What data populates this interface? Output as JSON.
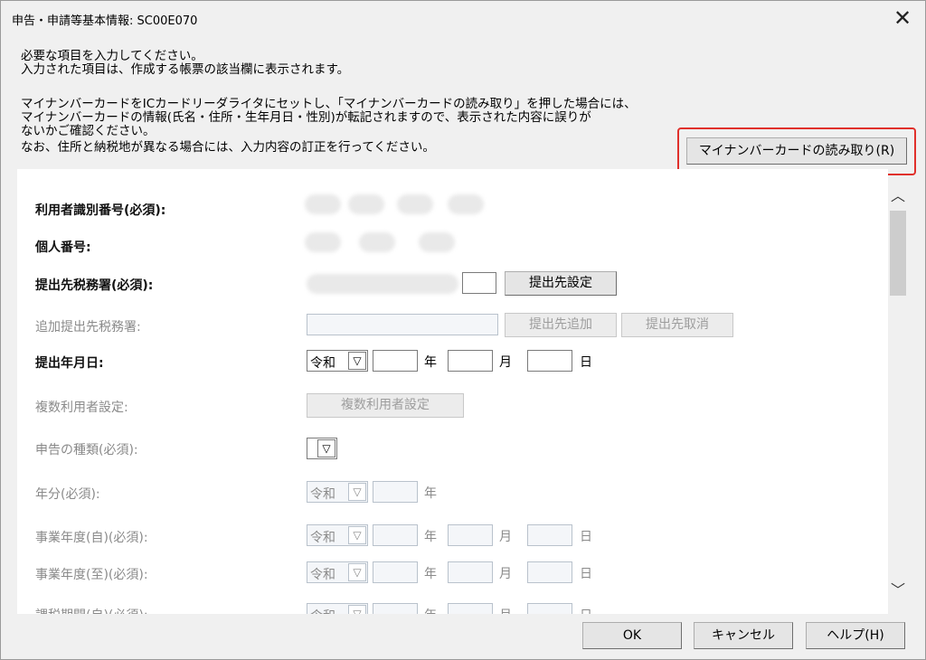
{
  "window": {
    "title": "申告・申請等基本情報: SC00E070"
  },
  "instructions": [
    "必要な項目を入力してください。",
    "入力された項目は、作成する帳票の該当欄に表示されます。",
    "マイナンバーカードをICカードリーダライタにセットし、「マイナンバーカードの読み取り」を押した場合には、",
    "マイナンバーカードの情報(氏名・住所・生年月日・性別)が転記されますので、表示された内容に誤りが",
    "ないかご確認ください。",
    "なお、住所と納税地が異なる場合には、入力内容の訂正を行ってください。"
  ],
  "mynumber_button": "マイナンバーカードの読み取り(R)",
  "form": {
    "user_id_label": "利用者識別番号(必須):",
    "personal_no_label": "個人番号:",
    "office_label": "提出先税務署(必須):",
    "office_set_button": "提出先設定",
    "additional_office_label": "追加提出先税務署:",
    "office_add_button": "提出先追加",
    "office_cancel_button": "提出先取消",
    "submit_date_label": "提出年月日:",
    "era": "令和",
    "year_unit": "年",
    "month_unit": "月",
    "day_unit": "日",
    "multi_user_label": "複数利用者設定:",
    "multi_user_button": "複数利用者設定",
    "report_type_label": "申告の種類(必須):",
    "year_label": "年分(必須):",
    "fiscal_from_label": "事業年度(自)(必須):",
    "fiscal_to_label": "事業年度(至)(必須):",
    "period_from_label": "課税期間(自)(必須):"
  },
  "buttons": {
    "ok": "OK",
    "cancel": "キャンセル",
    "help": "ヘルプ(H)"
  }
}
